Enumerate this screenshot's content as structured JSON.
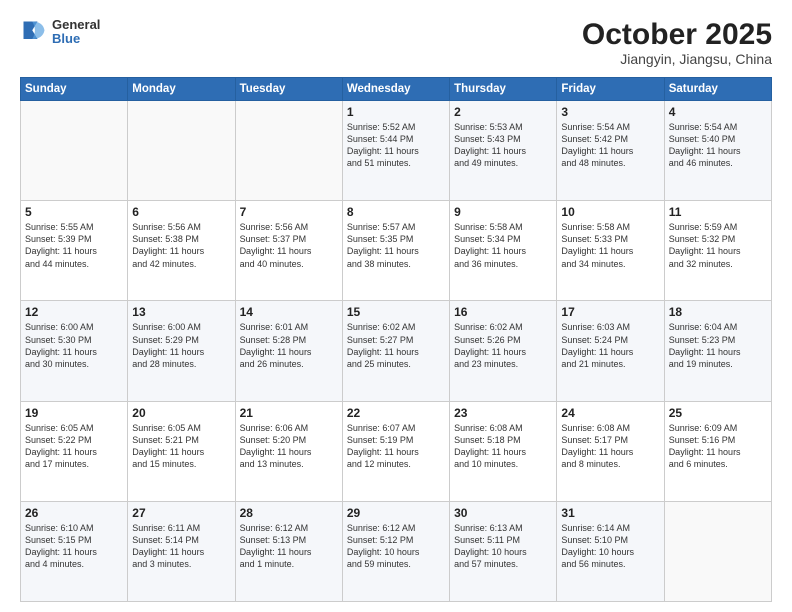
{
  "header": {
    "logo": {
      "line1": "General",
      "line2": "Blue"
    },
    "title": "October 2025",
    "subtitle": "Jiangyin, Jiangsu, China"
  },
  "weekdays": [
    "Sunday",
    "Monday",
    "Tuesday",
    "Wednesday",
    "Thursday",
    "Friday",
    "Saturday"
  ],
  "weeks": [
    [
      {
        "day": "",
        "info": ""
      },
      {
        "day": "",
        "info": ""
      },
      {
        "day": "",
        "info": ""
      },
      {
        "day": "1",
        "info": "Sunrise: 5:52 AM\nSunset: 5:44 PM\nDaylight: 11 hours\nand 51 minutes."
      },
      {
        "day": "2",
        "info": "Sunrise: 5:53 AM\nSunset: 5:43 PM\nDaylight: 11 hours\nand 49 minutes."
      },
      {
        "day": "3",
        "info": "Sunrise: 5:54 AM\nSunset: 5:42 PM\nDaylight: 11 hours\nand 48 minutes."
      },
      {
        "day": "4",
        "info": "Sunrise: 5:54 AM\nSunset: 5:40 PM\nDaylight: 11 hours\nand 46 minutes."
      }
    ],
    [
      {
        "day": "5",
        "info": "Sunrise: 5:55 AM\nSunset: 5:39 PM\nDaylight: 11 hours\nand 44 minutes."
      },
      {
        "day": "6",
        "info": "Sunrise: 5:56 AM\nSunset: 5:38 PM\nDaylight: 11 hours\nand 42 minutes."
      },
      {
        "day": "7",
        "info": "Sunrise: 5:56 AM\nSunset: 5:37 PM\nDaylight: 11 hours\nand 40 minutes."
      },
      {
        "day": "8",
        "info": "Sunrise: 5:57 AM\nSunset: 5:35 PM\nDaylight: 11 hours\nand 38 minutes."
      },
      {
        "day": "9",
        "info": "Sunrise: 5:58 AM\nSunset: 5:34 PM\nDaylight: 11 hours\nand 36 minutes."
      },
      {
        "day": "10",
        "info": "Sunrise: 5:58 AM\nSunset: 5:33 PM\nDaylight: 11 hours\nand 34 minutes."
      },
      {
        "day": "11",
        "info": "Sunrise: 5:59 AM\nSunset: 5:32 PM\nDaylight: 11 hours\nand 32 minutes."
      }
    ],
    [
      {
        "day": "12",
        "info": "Sunrise: 6:00 AM\nSunset: 5:30 PM\nDaylight: 11 hours\nand 30 minutes."
      },
      {
        "day": "13",
        "info": "Sunrise: 6:00 AM\nSunset: 5:29 PM\nDaylight: 11 hours\nand 28 minutes."
      },
      {
        "day": "14",
        "info": "Sunrise: 6:01 AM\nSunset: 5:28 PM\nDaylight: 11 hours\nand 26 minutes."
      },
      {
        "day": "15",
        "info": "Sunrise: 6:02 AM\nSunset: 5:27 PM\nDaylight: 11 hours\nand 25 minutes."
      },
      {
        "day": "16",
        "info": "Sunrise: 6:02 AM\nSunset: 5:26 PM\nDaylight: 11 hours\nand 23 minutes."
      },
      {
        "day": "17",
        "info": "Sunrise: 6:03 AM\nSunset: 5:24 PM\nDaylight: 11 hours\nand 21 minutes."
      },
      {
        "day": "18",
        "info": "Sunrise: 6:04 AM\nSunset: 5:23 PM\nDaylight: 11 hours\nand 19 minutes."
      }
    ],
    [
      {
        "day": "19",
        "info": "Sunrise: 6:05 AM\nSunset: 5:22 PM\nDaylight: 11 hours\nand 17 minutes."
      },
      {
        "day": "20",
        "info": "Sunrise: 6:05 AM\nSunset: 5:21 PM\nDaylight: 11 hours\nand 15 minutes."
      },
      {
        "day": "21",
        "info": "Sunrise: 6:06 AM\nSunset: 5:20 PM\nDaylight: 11 hours\nand 13 minutes."
      },
      {
        "day": "22",
        "info": "Sunrise: 6:07 AM\nSunset: 5:19 PM\nDaylight: 11 hours\nand 12 minutes."
      },
      {
        "day": "23",
        "info": "Sunrise: 6:08 AM\nSunset: 5:18 PM\nDaylight: 11 hours\nand 10 minutes."
      },
      {
        "day": "24",
        "info": "Sunrise: 6:08 AM\nSunset: 5:17 PM\nDaylight: 11 hours\nand 8 minutes."
      },
      {
        "day": "25",
        "info": "Sunrise: 6:09 AM\nSunset: 5:16 PM\nDaylight: 11 hours\nand 6 minutes."
      }
    ],
    [
      {
        "day": "26",
        "info": "Sunrise: 6:10 AM\nSunset: 5:15 PM\nDaylight: 11 hours\nand 4 minutes."
      },
      {
        "day": "27",
        "info": "Sunrise: 6:11 AM\nSunset: 5:14 PM\nDaylight: 11 hours\nand 3 minutes."
      },
      {
        "day": "28",
        "info": "Sunrise: 6:12 AM\nSunset: 5:13 PM\nDaylight: 11 hours\nand 1 minute."
      },
      {
        "day": "29",
        "info": "Sunrise: 6:12 AM\nSunset: 5:12 PM\nDaylight: 10 hours\nand 59 minutes."
      },
      {
        "day": "30",
        "info": "Sunrise: 6:13 AM\nSunset: 5:11 PM\nDaylight: 10 hours\nand 57 minutes."
      },
      {
        "day": "31",
        "info": "Sunrise: 6:14 AM\nSunset: 5:10 PM\nDaylight: 10 hours\nand 56 minutes."
      },
      {
        "day": "",
        "info": ""
      }
    ]
  ]
}
